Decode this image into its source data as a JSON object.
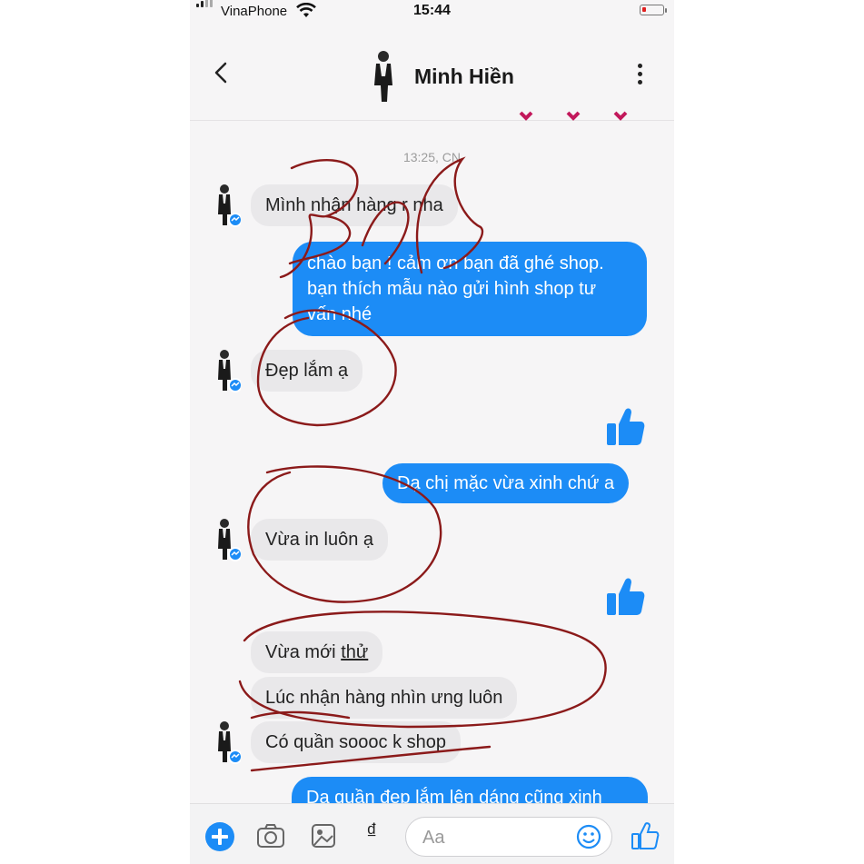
{
  "status": {
    "carrier": "VinaPhone",
    "time": "15:44"
  },
  "header": {
    "contact_name": "Minh Hiền"
  },
  "timestamp": "13:25, CN",
  "messages": {
    "m1": "Mình nhận hàng r nha",
    "m2_line1": "chào bạn ! cảm ơn bạn đã ghé shop.",
    "m2_line2": "bạn thích mẫu nào gửi hình shop tư",
    "m2_line3": "vấn nhé",
    "m3": "Đẹp lắm ạ",
    "m4": "Dạ chị mặc vừa xinh chứ a",
    "m5": "Vừa in luôn ạ",
    "m6_a": "Vừa mới ",
    "m6_b": "thử",
    "m7": "Lúc nhận hàng nhìn ưng luôn",
    "m8": "Có quần sooоc k shop",
    "m9": "Dạ quần đẹp lắm lên dáng cũng xinh"
  },
  "input": {
    "placeholder": "Aa",
    "currency_symbol": "₫"
  },
  "colors": {
    "accent": "#1c8cf6",
    "incoming_bubble": "#e9e8ea",
    "ink_marks": "#8b1a1a"
  }
}
